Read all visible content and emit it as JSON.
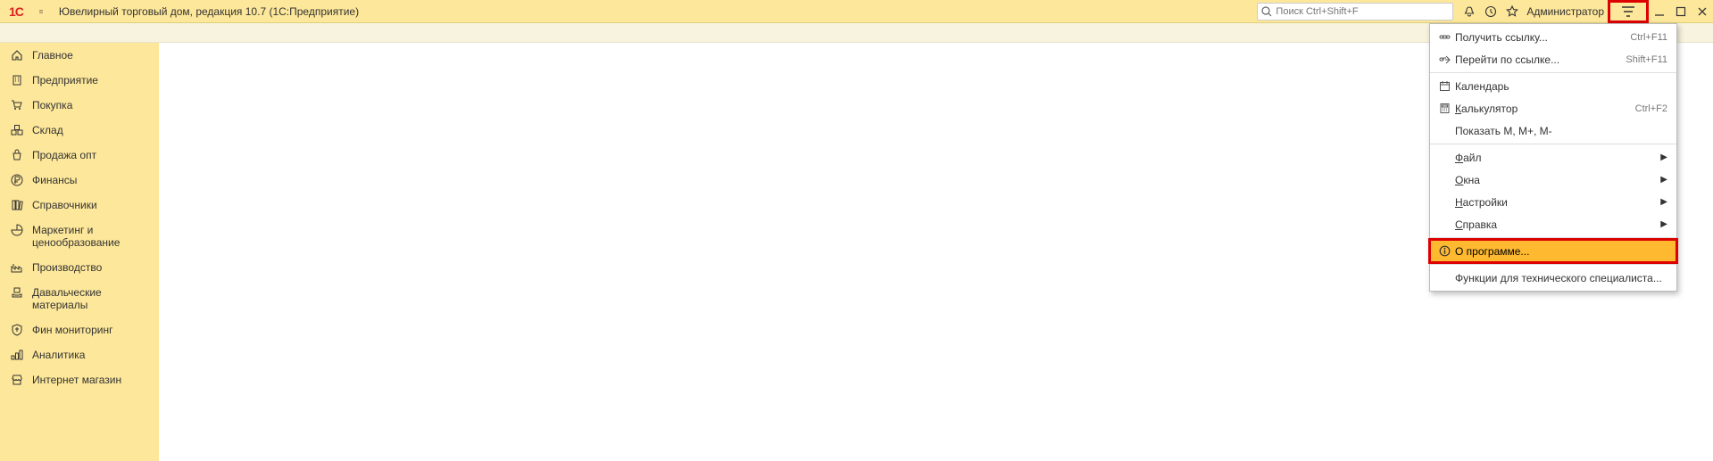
{
  "header": {
    "logo": "1C",
    "title": "Ювелирный торговый дом, редакция 10.7  (1С:Предприятие)",
    "search_placeholder": "Поиск Ctrl+Shift+F",
    "user": "Администратор"
  },
  "sidebar": {
    "items": [
      {
        "icon": "home",
        "label": "Главное"
      },
      {
        "icon": "building",
        "label": "Предприятие"
      },
      {
        "icon": "cart",
        "label": "Покупка"
      },
      {
        "icon": "boxes",
        "label": "Склад"
      },
      {
        "icon": "bag",
        "label": "Продажа опт"
      },
      {
        "icon": "ruble",
        "label": "Финансы"
      },
      {
        "icon": "books",
        "label": "Справочники"
      },
      {
        "icon": "pie",
        "label": "Маркетинг и ценообразование"
      },
      {
        "icon": "factory",
        "label": "Производство"
      },
      {
        "icon": "handbox",
        "label": "Давальческие материалы"
      },
      {
        "icon": "crest",
        "label": "Фин мониторинг"
      },
      {
        "icon": "bars",
        "label": "Аналитика"
      },
      {
        "icon": "shop",
        "label": "Интернет магазин"
      }
    ]
  },
  "dropdown": {
    "items": [
      {
        "icon": "link",
        "label": "Получить ссылку...",
        "shortcut": "Ctrl+F11"
      },
      {
        "icon": "linkarrow",
        "label": "Перейти по ссылке...",
        "shortcut": "Shift+F11"
      },
      {
        "sep": true
      },
      {
        "icon": "calendar",
        "label": "Календарь"
      },
      {
        "icon": "calc",
        "label": "Калькулятор",
        "shortcut": "Ctrl+F2",
        "ul": true
      },
      {
        "icon": "",
        "label": "Показать M, M+, M-"
      },
      {
        "sep": true
      },
      {
        "icon": "",
        "label": "Файл",
        "arrow": true,
        "ul": true
      },
      {
        "icon": "",
        "label": "Окна",
        "arrow": true,
        "ul": true
      },
      {
        "icon": "",
        "label": "Настройки",
        "arrow": true,
        "ul": true
      },
      {
        "icon": "",
        "label": "Справка",
        "arrow": true,
        "ul": true
      },
      {
        "sep": true
      },
      {
        "icon": "info",
        "label": "О программе...",
        "about": true
      },
      {
        "sep": true
      },
      {
        "icon": "",
        "label": "Функции для технического специалиста..."
      }
    ]
  }
}
